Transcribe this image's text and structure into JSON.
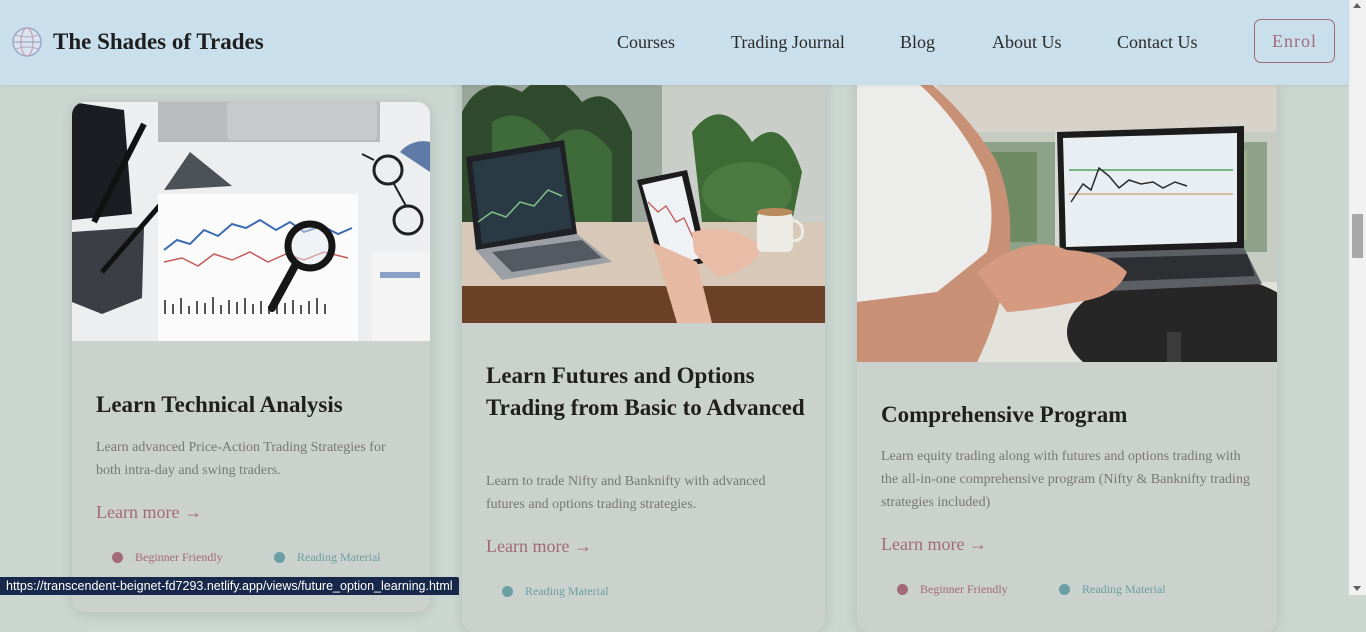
{
  "brand": {
    "name": "The Shades of Trades",
    "logo_icon": "globe-logo-icon"
  },
  "nav": {
    "items": [
      "Courses",
      "Trading Journal",
      "Blog",
      "About Us",
      "Contact Us"
    ],
    "enrol_label": "Enrol"
  },
  "cards": [
    {
      "image_icon": "trading-charts-desk-photo",
      "title": "Learn Technical Analysis",
      "desc": "Learn advanced Price-Action Trading Strategies for both intra-day and swing traders.",
      "learn_more": "Learn more →",
      "tags": [
        "Beginner Friendly",
        "Reading Material"
      ]
    },
    {
      "image_icon": "laptop-tablet-trading-photo",
      "title": "Learn Futures and Options Trading from Basic to Advanced",
      "desc": "Learn to trade Nifty and Banknifty with advanced futures and options trading strategies.",
      "learn_more": "Learn more →",
      "tags": [
        "Reading Material"
      ]
    },
    {
      "image_icon": "person-laptop-chart-photo",
      "title": "Comprehensive Program",
      "desc": "Learn equity trading along with futures and options trading with the all-in-one comprehensive program (Nifty & Banknifty trading strategies included)",
      "learn_more": "Learn more →",
      "tags": [
        "Beginner Friendly",
        "Reading Material"
      ]
    }
  ],
  "status_url": "https://transcendent-beignet-fd7293.netlify.app/views/future_option_learning.html",
  "colors": {
    "nav_bg": "#c9e0ec",
    "page_bg": "#ccd7d2",
    "accent": "#a26a78",
    "teal_dot": "#6a9ea2",
    "rose_dot": "#a26a78"
  }
}
